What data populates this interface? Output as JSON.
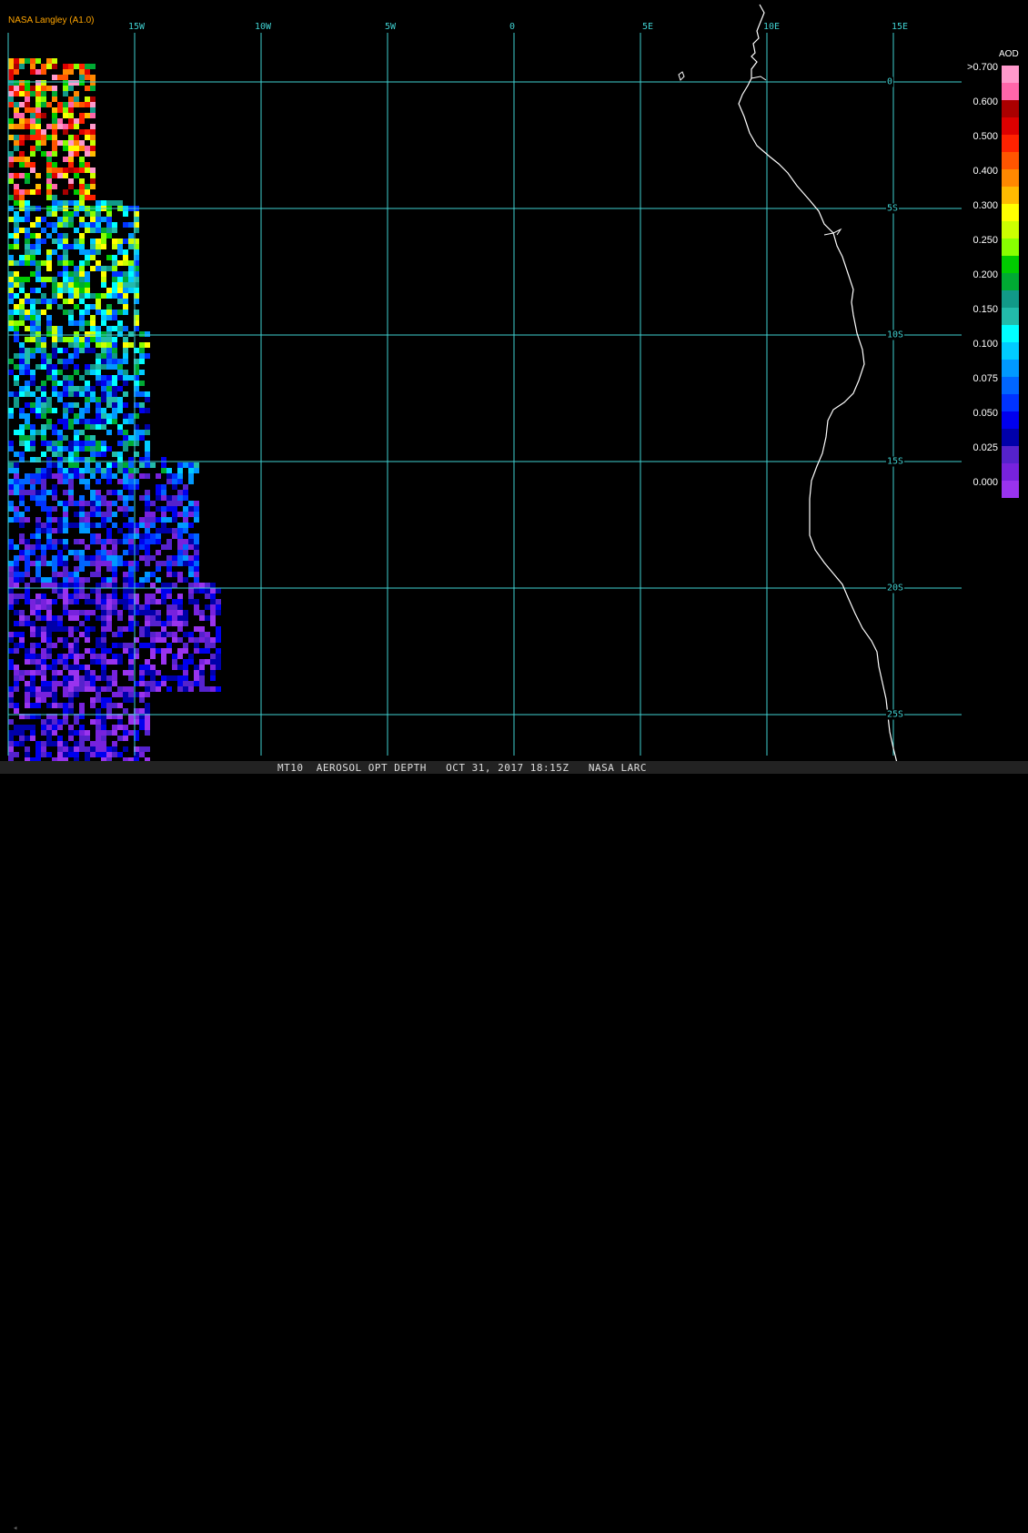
{
  "credit": "NASA Langley (A1.0)",
  "lon_labels": [
    "15W",
    "10W",
    "5W",
    "0",
    "5E",
    "10E",
    "15E"
  ],
  "lat_labels": [
    "0",
    "5S",
    "10S",
    "15S",
    "20S",
    "25S"
  ],
  "legend": {
    "title": "AOD",
    "labels": [
      ">0.700",
      "0.600",
      "0.500",
      "0.400",
      "0.300",
      "0.250",
      "0.200",
      "0.150",
      "0.100",
      "0.075",
      "0.050",
      "0.025",
      "0.000"
    ],
    "colors": [
      "#ff99cc",
      "#ff66aa",
      "#aa0000",
      "#dd0000",
      "#ff2200",
      "#ff5500",
      "#ff8800",
      "#ffbb00",
      "#ffff00",
      "#ccff00",
      "#88ff00",
      "#00cc00",
      "#00aa33",
      "#119988",
      "#22bbaa",
      "#00ffff",
      "#00ccff",
      "#0099ff",
      "#0066ff",
      "#0033ff",
      "#0000ee",
      "#0000aa",
      "#5522cc",
      "#7722dd",
      "#9933ee"
    ]
  },
  "footer": "MT10  AEROSOL OPT DEPTH   OCT 31, 2017 18:15Z   NASA LARC",
  "colors": {
    "grid": "#40d0d0",
    "coast": "#ffffff",
    "credit": "#ffa500"
  }
}
